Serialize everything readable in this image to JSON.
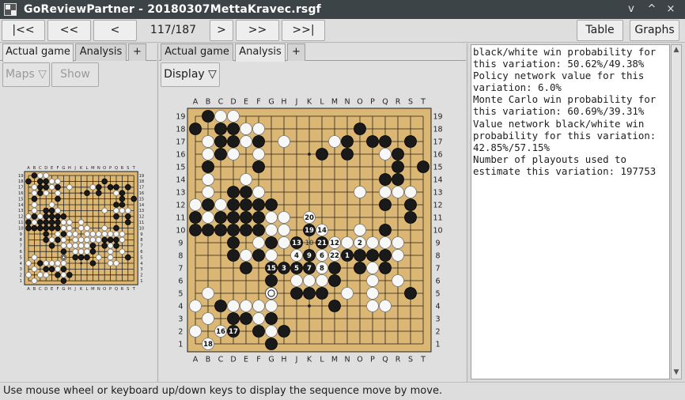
{
  "window": {
    "title": "GoReviewPartner - 20180307MettaKravec.rsgf",
    "controls": [
      "v",
      "^",
      "×"
    ]
  },
  "toolbar": {
    "first_label": "|<<",
    "back10_label": "<<",
    "back_label": "<",
    "move_counter": "117/187",
    "forward_label": ">",
    "forward10_label": ">>",
    "last_label": ">>|",
    "table_label": "Table",
    "graphs_label": "Graphs"
  },
  "left_panel": {
    "tabs": [
      "Actual game",
      "Analysis",
      "+"
    ],
    "active_tab": 0,
    "maps_label": "Maps ▽",
    "show_label": "Show"
  },
  "center_panel": {
    "tabs": [
      "Actual game",
      "Analysis",
      "+"
    ],
    "active_tab": 1,
    "display_label": "Display ▽"
  },
  "board": {
    "columns": [
      "A",
      "B",
      "C",
      "D",
      "E",
      "F",
      "G",
      "H",
      "J",
      "K",
      "L",
      "M",
      "N",
      "O",
      "P",
      "Q",
      "R",
      "S",
      "T"
    ],
    "rows": [
      "19",
      "18",
      "17",
      "16",
      "15",
      "14",
      "13",
      "12",
      "11",
      "10",
      "9",
      "8",
      "7",
      "6",
      "5",
      "4",
      "3",
      "2",
      "1"
    ],
    "board_color": "#dcb774",
    "black": "B19 A18 C18 D18 C17 D17 F17 C16 B15 F15 D13 B12 D12 F12 G12 A11 C11 E11 F11 B10 A10 C10 D10 E10 F10 D9 D8 F8 E7 H7 K9 M8 M7 M6 O8 O7 P8 Q8 Q7 S11 G6 J5 K5 L5 M4 S5 C4 D3 E3 G3 C2 F2 H2 G1 O18 P17 Q17 S17 R16 R15 T15 Q14 R14 Q12 S12 Q10 D11 E12 E13 N17 L16 N16 G9 L8",
    "white": "C19 D19 E18 F18 B17 C17 E17 C16 D16 F16 B16 B14 E14 B13 F13 G12 C12 A12 B11 G11 E11 H11 F9 G9 G8 E8 G10 G11 H9 H10 K8 L7 L6 K6 J6 N9 O9 P9 Q9 P7 P6 P5 O10 R9 R8 O13 Q14 Q13 R13 S13 Q16 H17 M17 L16 G5 B5 A4 B3 D4 E4 F4 G4 F3 G2 A2 B1 P4 Q4 R6 N8 M6 N5 J7",
    "numbered": [
      {
        "pt": "K11",
        "n": "20",
        "c": "w"
      },
      {
        "pt": "K10",
        "n": "19",
        "c": "b"
      },
      {
        "pt": "L10",
        "n": "14",
        "c": "w"
      },
      {
        "pt": "J9",
        "n": "13",
        "c": "b"
      },
      {
        "pt": "K9",
        "n": "10",
        "c": "x"
      },
      {
        "pt": "L9",
        "n": "21",
        "c": "b"
      },
      {
        "pt": "M9",
        "n": "12",
        "c": "w"
      },
      {
        "pt": "O9",
        "n": "2",
        "c": "w"
      },
      {
        "pt": "J8",
        "n": "4",
        "c": "w"
      },
      {
        "pt": "K8",
        "n": "9",
        "c": "b"
      },
      {
        "pt": "L8",
        "n": "6",
        "c": "w"
      },
      {
        "pt": "M8",
        "n": "22",
        "c": "w"
      },
      {
        "pt": "N8",
        "n": "1",
        "c": "b"
      },
      {
        "pt": "G7",
        "n": "15",
        "c": "b"
      },
      {
        "pt": "H7",
        "n": "3",
        "c": "b"
      },
      {
        "pt": "J7",
        "n": "5",
        "c": "b"
      },
      {
        "pt": "K7",
        "n": "7",
        "c": "b"
      },
      {
        "pt": "L7",
        "n": "8",
        "c": "w"
      },
      {
        "pt": "D2",
        "n": "17",
        "c": "b"
      },
      {
        "pt": "C2",
        "n": "16",
        "c": "w"
      },
      {
        "pt": "B1",
        "n": "18",
        "c": "w"
      }
    ],
    "last_move": "G5"
  },
  "comment": {
    "text": "black/white win probability for\nthis variation: 50.62%/49.38%\nPolicy network value for this\nvariation: 6.0%\nMonte Carlo win probability for\nthis variation: 60.69%/39.31%\nValue network black/white win\nprobability for this variation:\n42.85%/57.15%\nNumber of playouts used to\nestimate this variation: 197753"
  },
  "status": {
    "text": "Use mouse wheel or keyboard up/down keys to display the sequence move by move."
  }
}
